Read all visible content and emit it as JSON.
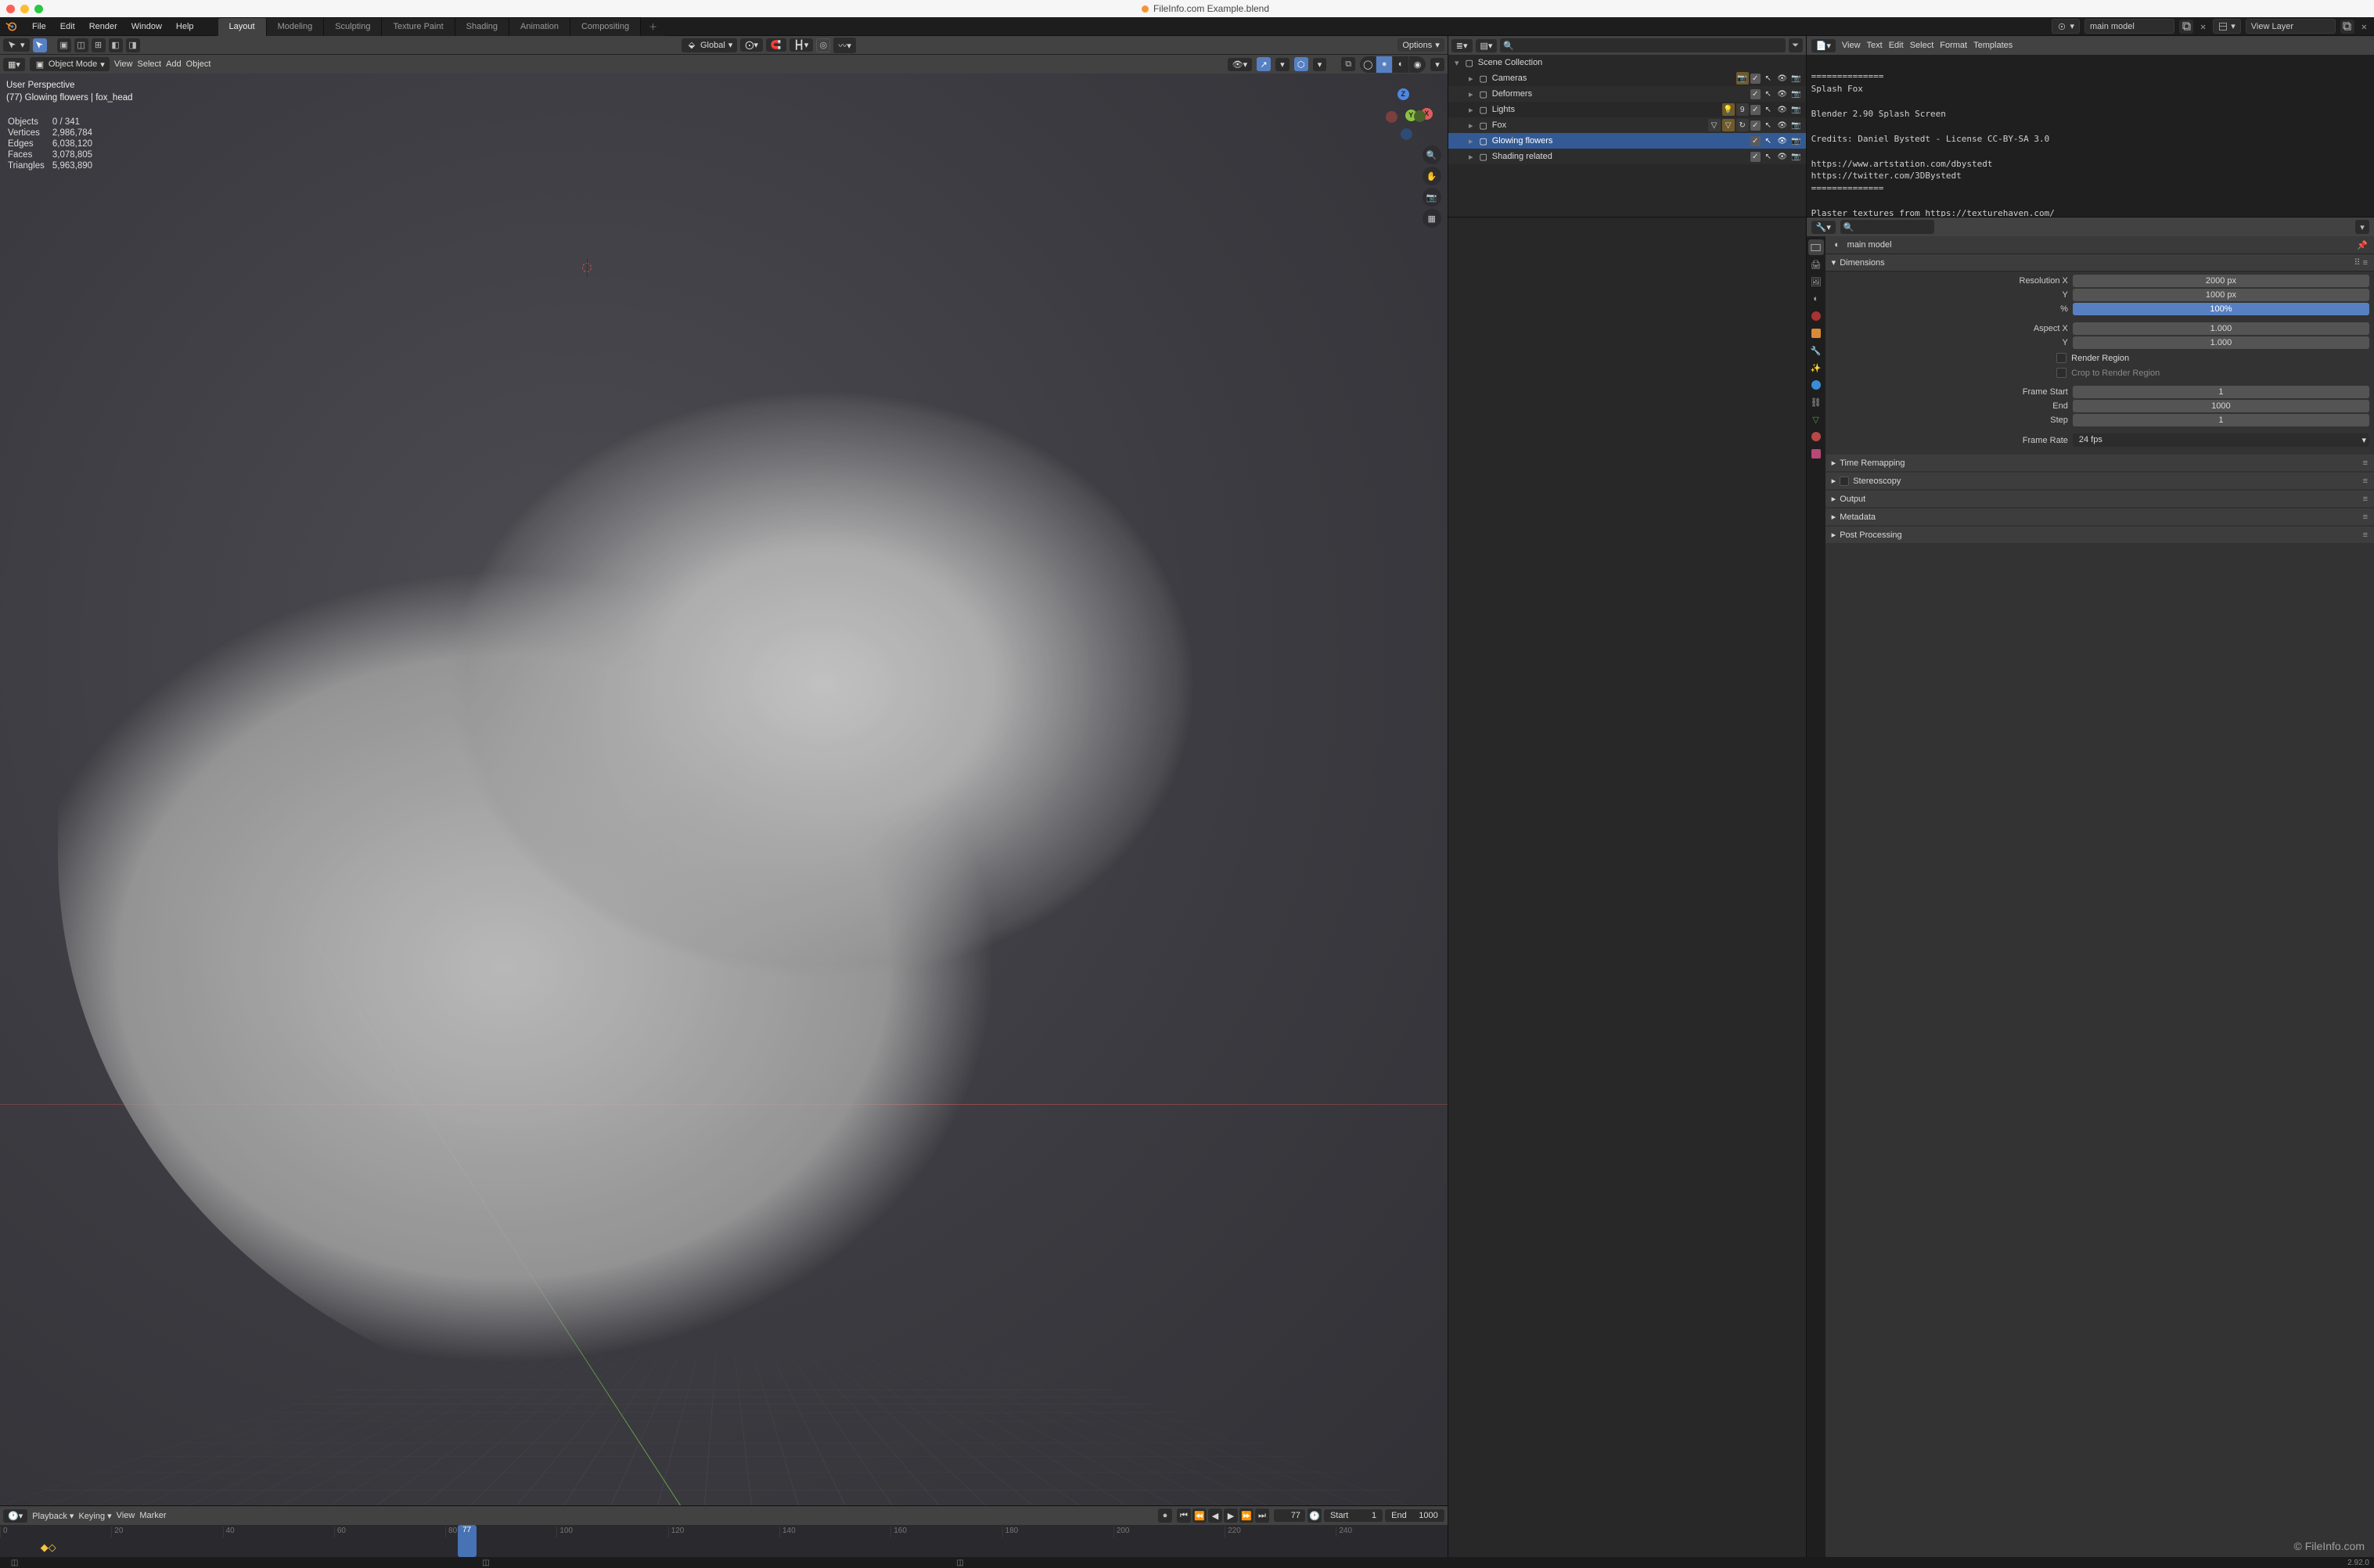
{
  "window_title": "FileInfo.com Example.blend",
  "main_menu": [
    "File",
    "Edit",
    "Render",
    "Window",
    "Help"
  ],
  "workspace_tabs": [
    "Layout",
    "Modeling",
    "Sculpting",
    "Texture Paint",
    "Shading",
    "Animation",
    "Compositing"
  ],
  "active_workspace": "Layout",
  "scene_field": "main model",
  "viewlayer_field": "View Layer",
  "viewport_header": {
    "mode": "Object Mode",
    "menus": [
      "View",
      "Select",
      "Add",
      "Object"
    ],
    "orientation": "Global",
    "options_label": "Options"
  },
  "viewport_overlay": {
    "line1": "User Perspective",
    "line2": "(77) Glowing flowers | fox_head",
    "stats": {
      "Objects": "0 / 341",
      "Vertices": "2,986,784",
      "Edges": "6,038,120",
      "Faces": "3,078,805",
      "Triangles": "5,963,890"
    },
    "gizmo_labels": {
      "x": "X",
      "y": "Y",
      "z": "Z"
    }
  },
  "outliner": {
    "root": "Scene Collection",
    "items": [
      {
        "name": "Cameras"
      },
      {
        "name": "Deformers"
      },
      {
        "name": "Lights",
        "count": "9"
      },
      {
        "name": "Fox"
      },
      {
        "name": "Glowing flowers",
        "selected": true
      },
      {
        "name": "Shading related"
      }
    ]
  },
  "text_editor": {
    "menus": [
      "View",
      "Text",
      "Edit",
      "Select",
      "Format",
      "Templates"
    ],
    "content": "==============\nSplash Fox\n\nBlender 2.90 Splash Screen\n\nCredits: Daniel Bystedt - License CC-BY-SA 3.0\n\nhttps://www.artstation.com/dbystedt\nhttps://twitter.com/3DBystedt\n==============\n\nPlaster textures from https://texturehaven.com/\n\n==============\n\nSwitch between the different workspace tabs in\nthe top to see more information about this\nBlender file."
  },
  "properties": {
    "scene_name": "main model",
    "panel_title": "Dimensions",
    "resolution": {
      "x_label": "Resolution X",
      "x": "2000 px",
      "y_label": "Y",
      "y": "1000 px",
      "pct_label": "%",
      "pct": "100%"
    },
    "aspect": {
      "x_label": "Aspect X",
      "x": "1.000",
      "y_label": "Y",
      "y": "1.000"
    },
    "render_region": "Render Region",
    "crop_region": "Crop to Render Region",
    "frames": {
      "start_label": "Frame Start",
      "start": "1",
      "end_label": "End",
      "end": "1000",
      "step_label": "Step",
      "step": "1"
    },
    "frame_rate_label": "Frame Rate",
    "frame_rate": "24 fps",
    "collapsed_panels": [
      "Time Remapping",
      "Stereoscopy",
      "Output",
      "Metadata",
      "Post Processing"
    ]
  },
  "timeline": {
    "menus": [
      "Playback",
      "Keying",
      "View",
      "Marker"
    ],
    "current_frame": "77",
    "start_label": "Start",
    "start": "1",
    "end_label": "End",
    "end": "1000",
    "ticks": [
      "0",
      "20",
      "40",
      "60",
      "80",
      "100",
      "120",
      "140",
      "160",
      "180",
      "200",
      "220",
      "240"
    ]
  },
  "status": {
    "version": "2.92.0"
  },
  "watermark": "© FileInfo.com"
}
